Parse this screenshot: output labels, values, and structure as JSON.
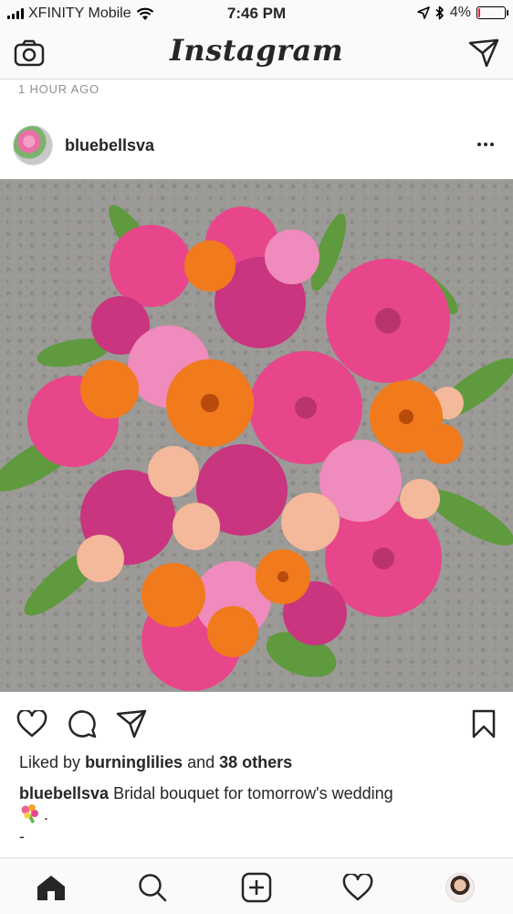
{
  "status_bar": {
    "carrier": "XFINITY Mobile",
    "time": "7:46 PM",
    "battery_percent": "4%",
    "battery_level": 0.04,
    "battery_color": "#e0232e"
  },
  "header": {
    "logo_text": "Instagram",
    "left_icon": "camera-icon",
    "right_icon": "direct-message-icon"
  },
  "feed": {
    "time_ago": "1 HOUR AGO"
  },
  "post": {
    "username": "bluebellsva",
    "likes": {
      "prefix": "Liked by",
      "first_liker": "burninglilies",
      "connector": "and",
      "others": "38 others"
    },
    "caption": {
      "username": "bluebellsva",
      "text": "Bridal bouquet for tomorrow's wedding",
      "emoji_suffix": ".",
      "second_line": "-"
    },
    "actions": [
      "heart-icon",
      "comment-icon",
      "share-icon",
      "bookmark-icon"
    ]
  },
  "tab_bar": {
    "items": [
      "home-icon",
      "search-icon",
      "new-post-icon",
      "activity-icon",
      "profile-avatar"
    ],
    "active": "home-icon"
  },
  "colors": {
    "text": "#262626",
    "secondary_text": "#8e8e8e",
    "border": "#dbdbdb",
    "bar_bg": "#fafafa"
  }
}
